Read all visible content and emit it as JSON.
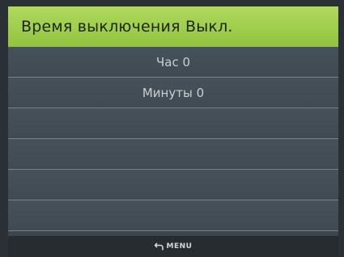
{
  "header": {
    "title": "Время выключения Выкл."
  },
  "menu_items": [
    {
      "label": "Час 0"
    },
    {
      "label": "Минуты 0"
    },
    {
      "label": ""
    },
    {
      "label": ""
    },
    {
      "label": ""
    },
    {
      "label": ""
    }
  ],
  "footer": {
    "menu_label": "MENU",
    "menu_icon": "return-arrow-icon"
  },
  "colors": {
    "title_bar": "#9fcd4c",
    "list_background": "#3d464c",
    "row_divider": "#73808a",
    "footer_background": "#262c30",
    "text_light": "#c9d0d5"
  }
}
